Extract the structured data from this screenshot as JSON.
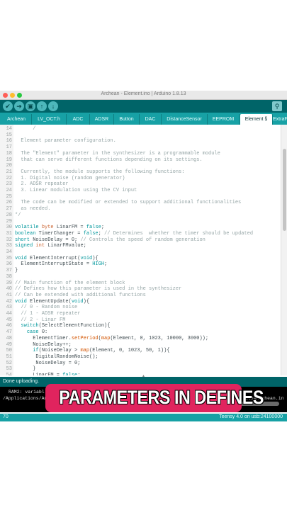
{
  "window": {
    "title": "Archean - Element.ino | Arduino 1.8.13"
  },
  "toolbar": {
    "buttons": [
      {
        "name": "verify-button",
        "glyph": "✔"
      },
      {
        "name": "upload-button",
        "glyph": "➔"
      },
      {
        "name": "new-button",
        "glyph": "▣"
      },
      {
        "name": "open-button",
        "glyph": "↑"
      },
      {
        "name": "save-button",
        "glyph": "↓"
      }
    ],
    "serial_monitor_glyph": "⚲"
  },
  "tabs": [
    "Archean",
    "LV_OCT.h",
    "ADC",
    "ADSR",
    "Button",
    "DAC",
    "DistanceSensor",
    "EEPROM",
    "Element §",
    "ExtraFu"
  ],
  "editor": {
    "lines": [
      {
        "n": "14",
        "text": "      /"
      },
      {
        "n": "15",
        "text": ""
      },
      {
        "n": "16",
        "text": "  Element parameter configuration."
      },
      {
        "n": "17",
        "text": ""
      },
      {
        "n": "18",
        "text": "  The \"Element\" parameter in the synthesizer is a programmable module"
      },
      {
        "n": "19",
        "text": "  that can serve different functions depending on its settings."
      },
      {
        "n": "20",
        "text": ""
      },
      {
        "n": "21",
        "text": "  Currently, the module supports the following functions:"
      },
      {
        "n": "22",
        "text": "  1. Digital noise (random generator)"
      },
      {
        "n": "23",
        "text": "  2. ADSR repeater"
      },
      {
        "n": "24",
        "text": "  3. Linear modulation using the CV input"
      },
      {
        "n": "25",
        "text": ""
      },
      {
        "n": "26",
        "text": "  The code can be modified or extended to support additional functionalities"
      },
      {
        "n": "27",
        "text": "  as needed."
      },
      {
        "n": "28",
        "text": "*/"
      },
      {
        "n": "29",
        "text": ""
      },
      {
        "n": "30",
        "text": "volatile byte LinarFM = false;"
      },
      {
        "n": "31",
        "text": "boolean TimerChanger = false; // Determines  whether the timer should be updated"
      },
      {
        "n": "32",
        "text": "short NoiseDelay = 0; // Controls the speed of random generation"
      },
      {
        "n": "33",
        "text": "signed int LinarFMvalue;"
      },
      {
        "n": "34",
        "text": ""
      },
      {
        "n": "35",
        "text": "void ElementInterrupt(void){"
      },
      {
        "n": "36",
        "text": "  ElementInterruptState = HIGH;"
      },
      {
        "n": "37",
        "text": "}"
      },
      {
        "n": "38",
        "text": ""
      },
      {
        "n": "39",
        "text": "// Main function of the element block"
      },
      {
        "n": "40",
        "text": "// Defines how this parameter is used in the synthesizer"
      },
      {
        "n": "41",
        "text": "// Can be extended with additional functions"
      },
      {
        "n": "42",
        "text": "void ElementUpdate(void){"
      },
      {
        "n": "43",
        "text": "  // 0 - Random noise"
      },
      {
        "n": "44",
        "text": "  // 1 - ADSR repeater"
      },
      {
        "n": "45",
        "text": "  // 2 - Linar FM"
      },
      {
        "n": "46",
        "text": "  switch(SelectElementFunction){"
      },
      {
        "n": "47",
        "text": "    case 0:"
      },
      {
        "n": "48",
        "text": "      ElementTimer.setPeriod(map(Element, 0, 1023, 10000, 3000));"
      },
      {
        "n": "49",
        "text": "      NoiseDelay++;"
      },
      {
        "n": "50",
        "text": "      if(NoiseDelay > map(Element, 0, 1023, 50, 1)){"
      },
      {
        "n": "51",
        "text": "       DigitalRandomNoise();"
      },
      {
        "n": "52",
        "text": "       NoiseDelay = 0;"
      },
      {
        "n": "53",
        "text": "      }"
      },
      {
        "n": "54",
        "text": "      LinarFM = false;"
      }
    ]
  },
  "status": {
    "message": "Done uploading."
  },
  "console": {
    "line1": "RAM2: variabl",
    "line2": "/Applications/Ar",
    "line2_tail": "file=Archean.in"
  },
  "bottombar": {
    "line_number": "70",
    "board": "Teensy 4.0 on usb:24100000"
  },
  "caption": {
    "text": "PARAMETERS IN DEFINES"
  },
  "colors": {
    "toolbar": "#006468",
    "tabs": "#17a1a5",
    "caption": "#e0245e"
  }
}
